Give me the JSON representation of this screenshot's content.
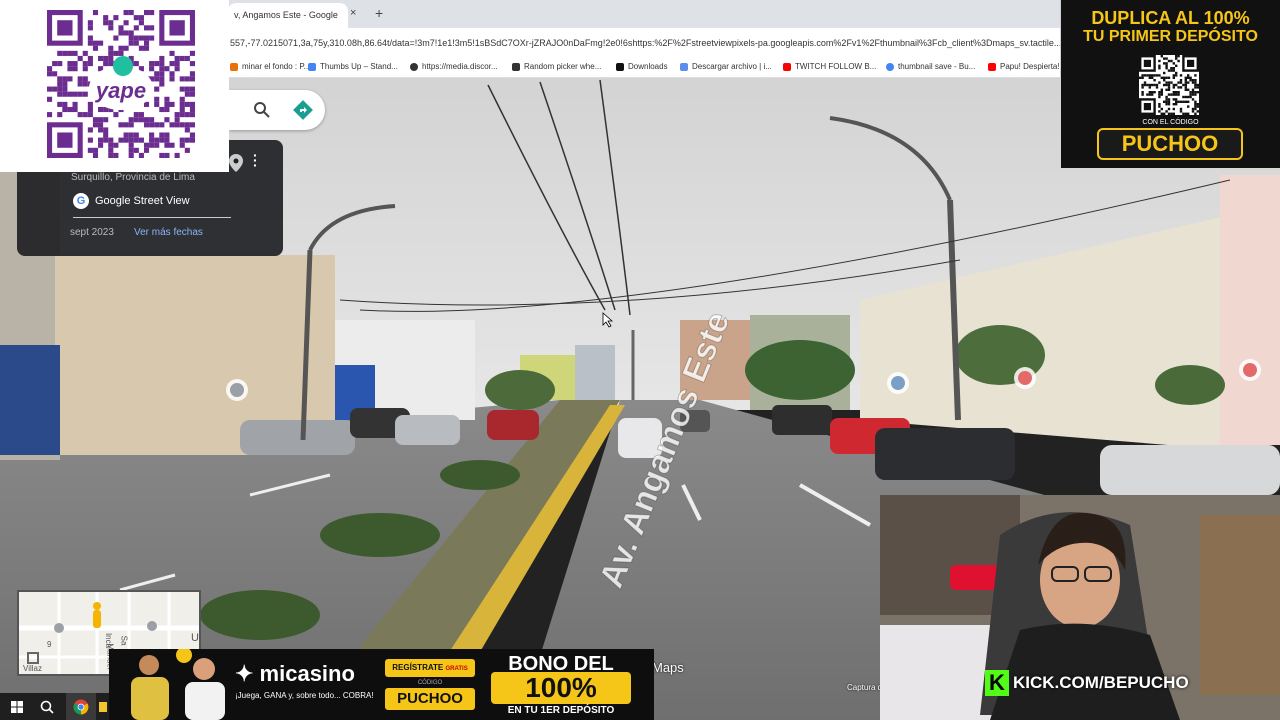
{
  "browser": {
    "tab_title": "v, Angamos Este - Google",
    "tab_close": "×",
    "new_tab": "+",
    "url": "557,-77.0215071,3a,75y,310.08h,86.64t/data=!3m7!1e1!3m5!1sBSdC7OXr-jZRAJO0nDaFmg!2e0!6shttps:%2F%2Fstreetviewpixels-pa.googleapis.com%2Fv1%2Fthumbnail%3Fcb_client%3Dmaps_sv.tactile...",
    "bookmarks": [
      {
        "label": "minar el fondo : P...",
        "color": "#e8710a"
      },
      {
        "label": "Thumbs Up – Stand...",
        "color": "#4285f4"
      },
      {
        "label": "https://media.discor...",
        "color": "#333333"
      },
      {
        "label": "Random picker whe...",
        "color": "#333333"
      },
      {
        "label": "Downloads",
        "color": "#111111"
      },
      {
        "label": "Descargar archivo | i...",
        "color": "#5b8def"
      },
      {
        "label": "TWITCH FOLLOW B...",
        "color": "#ff0000"
      },
      {
        "label": "thumbnail save - Bu...",
        "color": "#4285f4"
      },
      {
        "label": "Papu! Despierta!",
        "color": "#ff0000"
      }
    ]
  },
  "maps": {
    "search_icon": "search-icon",
    "directions_icon": "directions-icon",
    "info_card": {
      "location": "Surquillo, Provincia de Lima",
      "source": "Google Street View",
      "date": "sept 2023",
      "more_dates": "Ver más fechas"
    },
    "street_label": "Av. Angamos Este",
    "maps_label": "Maps",
    "capture_label": "Captura d"
  },
  "minimap": {
    "streets": [
      "Inca",
      "Manuel",
      "Sa",
      "9",
      "U",
      "Villaz"
    ]
  },
  "overlays": {
    "yape_qr": {
      "brand": "yape"
    },
    "promo_top": {
      "line1": "DUPLICA AL 100%",
      "line2": "TU PRIMER DEPÓSITO",
      "subline": "CON EL CÓDIGO",
      "code": "PUCHOO"
    },
    "promo_bottom": {
      "logo": "micasino",
      "tagline": "¡Juega, GANA y, sobre todo... COBRA!",
      "register": "REGÍSTRATE",
      "free": "GRATIS",
      "code_label": "CÓDIGO",
      "code": "PUCHOO",
      "bono": "BONO DEL",
      "percent": "100%",
      "deposit": "EN TU 1ER DEPÓSITO"
    },
    "kick": {
      "letter": "K",
      "url": "KICK.COM/BEPUCHO"
    }
  },
  "colors": {
    "accent_yellow": "#f5c518",
    "kick_green": "#53fc18",
    "yape_purple": "#6b2d8f",
    "sky": "#d9d9d9"
  }
}
